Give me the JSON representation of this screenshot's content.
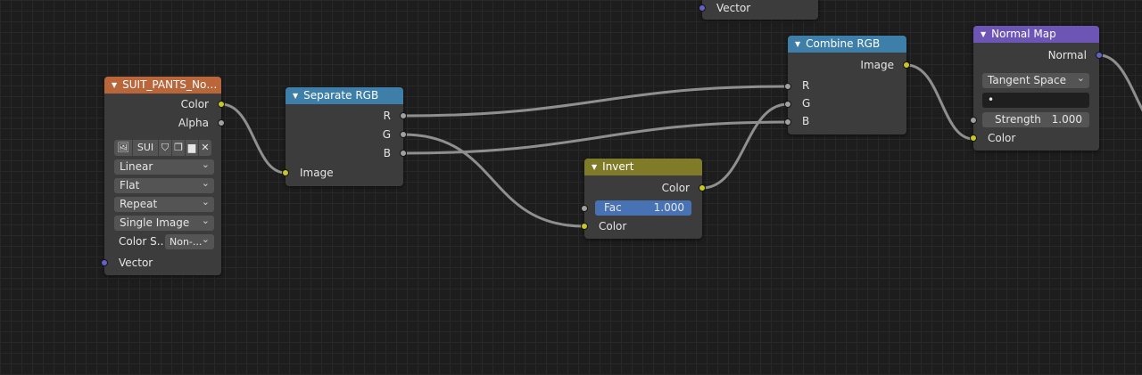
{
  "nodes": {
    "image_texture": {
      "title": "SUIT_PANTS_Norm...",
      "color": "#b8663a",
      "outputs": {
        "color": "Color",
        "alpha": "Alpha"
      },
      "image_name": "SUI",
      "interpolation": "Linear",
      "projection": "Flat",
      "extension": "Repeat",
      "source": "Single Image",
      "color_space_label": "Color S..",
      "color_space_value": "Non-...",
      "inputs": {
        "vector": "Vector"
      }
    },
    "separate_rgb": {
      "title": "Separate RGB",
      "color": "#3d7fa8",
      "outputs": {
        "r": "R",
        "g": "G",
        "b": "B"
      },
      "inputs": {
        "image": "Image"
      }
    },
    "invert": {
      "title": "Invert",
      "color": "#807b29",
      "outputs": {
        "color": "Color"
      },
      "fac_label": "Fac",
      "fac_value": "1.000",
      "inputs": {
        "color": "Color"
      }
    },
    "combine_rgb": {
      "title": "Combine RGB",
      "color": "#3d7fa8",
      "outputs": {
        "image": "Image"
      },
      "inputs": {
        "r": "R",
        "g": "G",
        "b": "B"
      }
    },
    "normal_map": {
      "title": "Normal Map",
      "color": "#6c55b5",
      "outputs": {
        "normal": "Normal"
      },
      "space": "Tangent Space",
      "uv_map": "•",
      "strength_label": "Strength",
      "strength_value": "1.000",
      "inputs": {
        "color": "Color"
      }
    },
    "top_partial": {
      "inputs": {
        "vector": "Vector"
      }
    }
  },
  "socket_colors": {
    "color": "#c7c729",
    "float": "#a1a1a1",
    "vector": "#6363c7"
  },
  "wire_color": "#8f8f8f"
}
